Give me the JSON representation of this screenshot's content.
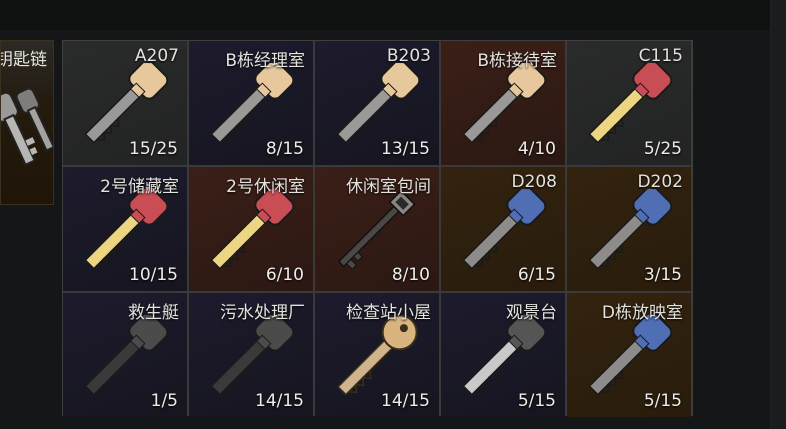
{
  "side_item": {
    "label": "钥匙链",
    "icon": "keychain-icon"
  },
  "keys": [
    {
      "name": "A207",
      "count": "15/25",
      "style": "gray",
      "head": "#e7c79c",
      "blade": "#9b9997",
      "kind": "flat"
    },
    {
      "name": "B栋经理室",
      "count": "8/15",
      "style": "dark",
      "head": "#e7c79c",
      "blade": "#9b9997",
      "kind": "flat"
    },
    {
      "name": "B203",
      "count": "13/15",
      "style": "dark",
      "head": "#e7c79c",
      "blade": "#9b9997",
      "kind": "flat"
    },
    {
      "name": "B栋接待室",
      "count": "4/10",
      "style": "red",
      "head": "#e7c79c",
      "blade": "#9b9997",
      "kind": "flat"
    },
    {
      "name": "C115",
      "count": "5/25",
      "style": "gray",
      "head": "#c94d55",
      "blade": "#ecd583",
      "kind": "flat"
    },
    {
      "name": "2号储藏室",
      "count": "10/15",
      "style": "dark",
      "head": "#c94d55",
      "blade": "#ecd583",
      "kind": "flat"
    },
    {
      "name": "2号休闲室",
      "count": "6/10",
      "style": "red",
      "head": "#c94d55",
      "blade": "#ecd583",
      "kind": "flat"
    },
    {
      "name": "休闲室包间",
      "count": "8/10",
      "style": "red",
      "head": "#8a8783",
      "blade": "#4a4846",
      "kind": "skeleton"
    },
    {
      "name": "D208",
      "count": "6/15",
      "style": "orange",
      "head": "#4f6eb4",
      "blade": "#8e8c8a",
      "kind": "flat"
    },
    {
      "name": "D202",
      "count": "3/15",
      "style": "orange",
      "head": "#4f6eb4",
      "blade": "#8e8c8a",
      "kind": "flat"
    },
    {
      "name": "救生艇",
      "count": "1/5",
      "style": "dark",
      "head": "#4b4b4b",
      "blade": "#3a3a3a",
      "kind": "flat"
    },
    {
      "name": "污水处理厂",
      "count": "14/15",
      "style": "dark",
      "head": "#4b4b4b",
      "blade": "#3a3a3a",
      "kind": "flat"
    },
    {
      "name": "检查站小屋",
      "count": "14/15",
      "style": "dark",
      "head": "#d8b47e",
      "blade": "#cfb48d",
      "kind": "round"
    },
    {
      "name": "观景台",
      "count": "5/15",
      "style": "dark",
      "head": "#555555",
      "blade": "#c9c9c9",
      "kind": "flat"
    },
    {
      "name": "D栋放映室",
      "count": "5/15",
      "style": "orange",
      "head": "#4f6eb4",
      "blade": "#8e8c8a",
      "kind": "flat"
    }
  ]
}
